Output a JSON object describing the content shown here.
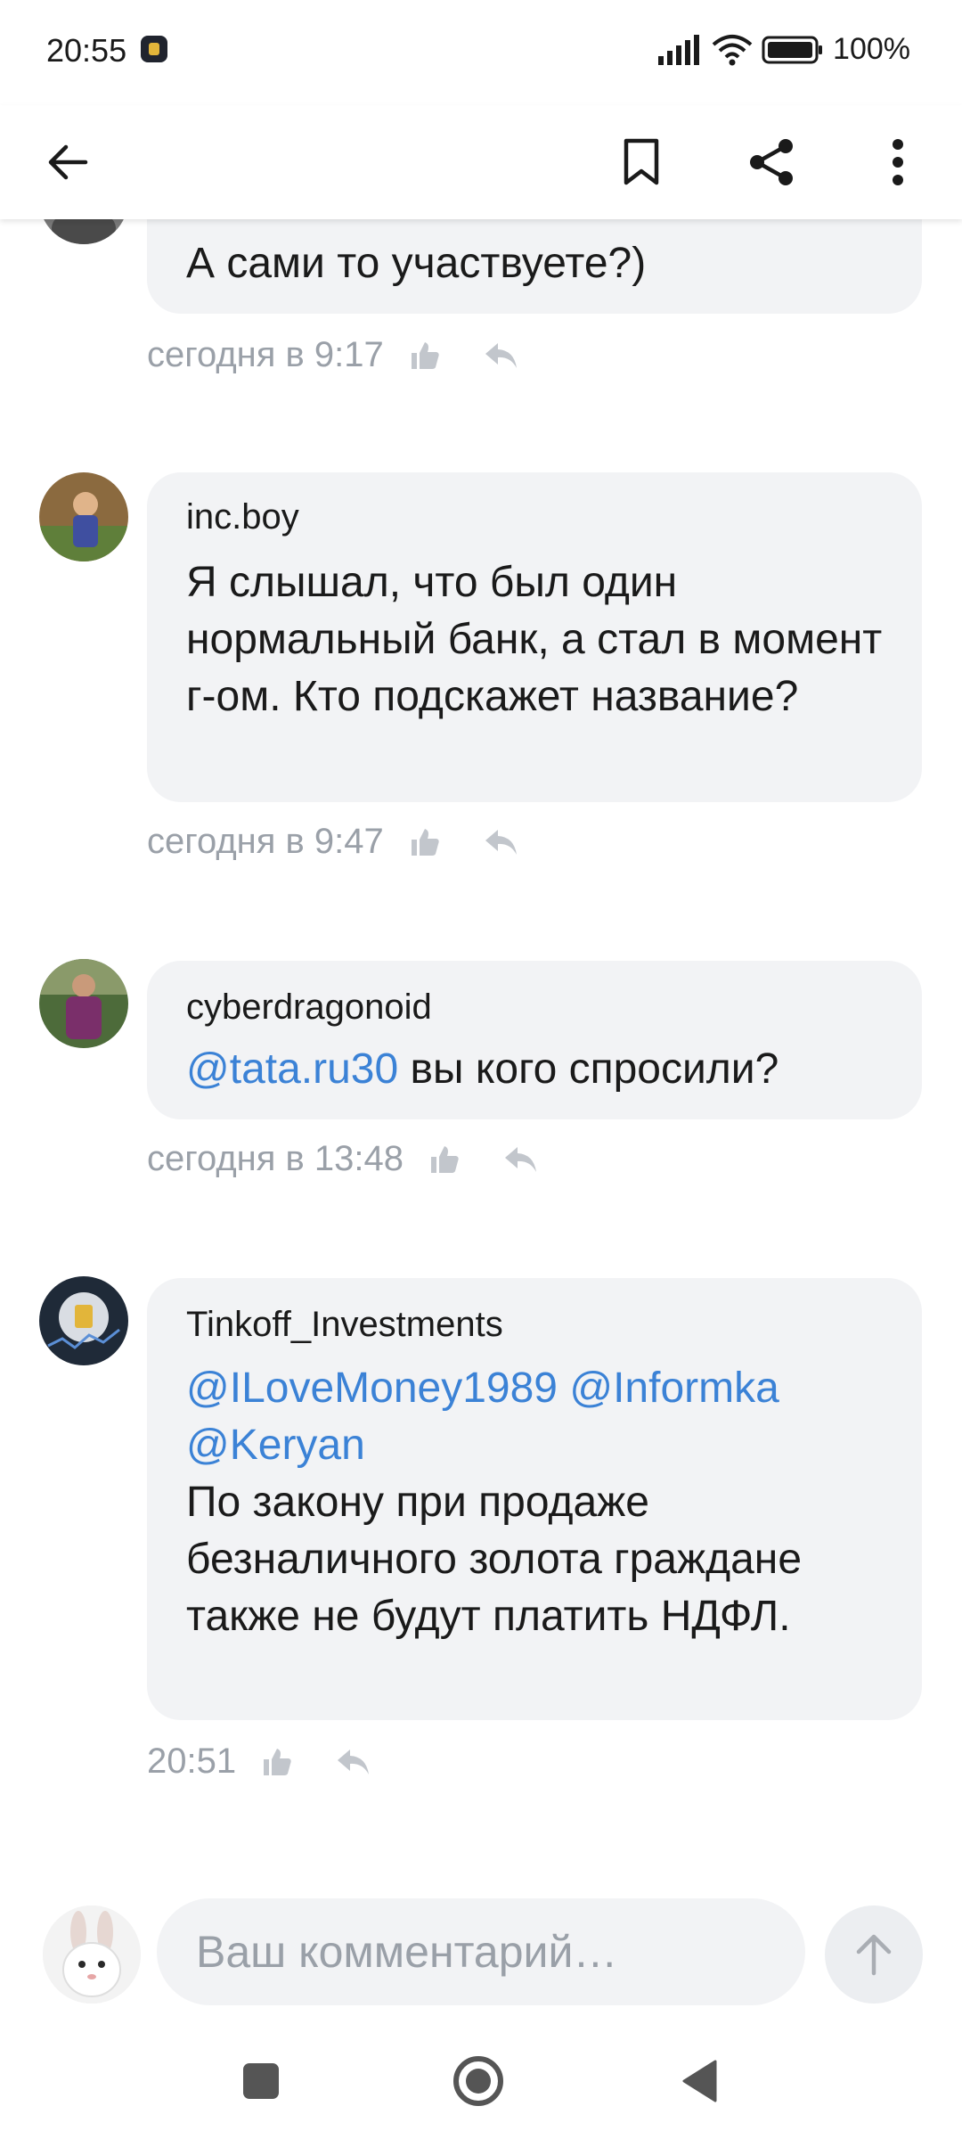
{
  "status_bar": {
    "time": "20:55",
    "battery": "100%"
  },
  "toolbar": {
    "back_icon": "arrow-left-icon",
    "bookmark_icon": "bookmark-icon",
    "share_icon": "share-icon",
    "more_icon": "more-vertical-icon"
  },
  "comments": [
    {
      "author": "",
      "text": "А сами то участвуете?)",
      "time": "сегодня в 9:17"
    },
    {
      "author": "inc.boy",
      "text": "Я слышал, что был один нормальный банк, а стал в момент г-ом. Кто подскажет название?",
      "time": "сегодня в 9:47"
    },
    {
      "author": "cyberdragonoid",
      "mention": "@tata.ru30",
      "text": " вы кого спросили?",
      "time": "сегодня в 13:48"
    },
    {
      "author": "Tinkoff_Investments",
      "mentions": [
        "@ILoveMoney1989",
        "@Informka",
        "@Keryan"
      ],
      "text": "По закону при продаже безналичного золота граждане также не будут платить НДФЛ.",
      "time": "20:51"
    }
  ],
  "composer": {
    "placeholder": "Ваш комментарий…",
    "send_icon": "arrow-up-icon"
  },
  "nav_bar": {
    "recents_icon": "square-icon",
    "home_icon": "circle-icon",
    "back_icon": "triangle-back-icon"
  },
  "colors": {
    "mention": "#3b82d6",
    "bubble": "#f2f3f5",
    "meta": "#9aa0a8"
  }
}
